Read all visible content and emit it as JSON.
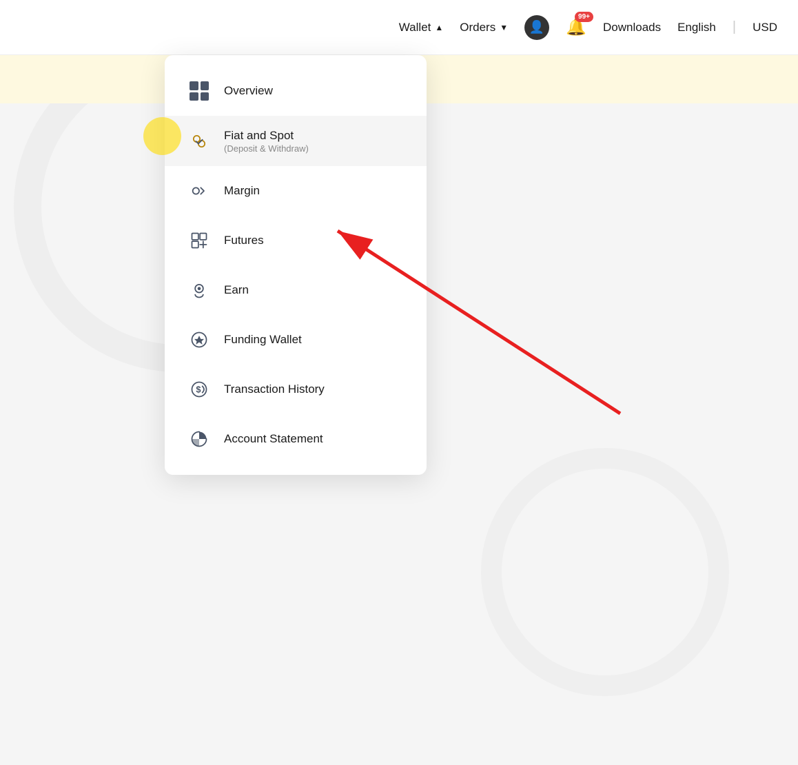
{
  "navbar": {
    "wallet_label": "Wallet",
    "orders_label": "Orders",
    "downloads_label": "Downloads",
    "english_label": "English",
    "usd_label": "USD",
    "notification_badge": "99+",
    "wallet_arrow": "▲",
    "orders_arrow": "▼"
  },
  "dropdown": {
    "items": [
      {
        "id": "overview",
        "label": "Overview",
        "sub": "",
        "icon_type": "grid"
      },
      {
        "id": "fiat-and-spot",
        "label": "Fiat and Spot",
        "sub": "(Deposit & Withdraw)",
        "icon_type": "fiat",
        "highlighted": true
      },
      {
        "id": "margin",
        "label": "Margin",
        "sub": "",
        "icon_type": "margin"
      },
      {
        "id": "futures",
        "label": "Futures",
        "sub": "",
        "icon_type": "futures"
      },
      {
        "id": "earn",
        "label": "Earn",
        "sub": "",
        "icon_type": "earn"
      },
      {
        "id": "funding-wallet",
        "label": "Funding Wallet",
        "sub": "",
        "icon_type": "funding"
      },
      {
        "id": "transaction-history",
        "label": "Transaction History",
        "sub": "",
        "icon_type": "transaction"
      },
      {
        "id": "account-statement",
        "label": "Account Statement",
        "sub": "",
        "icon_type": "statement"
      }
    ]
  },
  "annotation": {
    "arrow_color": "#e82020"
  }
}
